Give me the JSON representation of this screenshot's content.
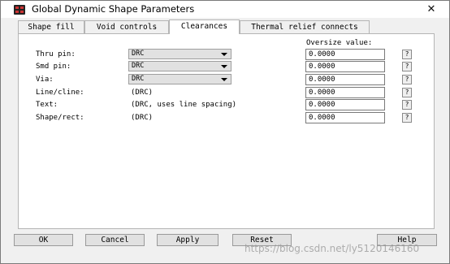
{
  "window": {
    "title": "Global Dynamic Shape Parameters",
    "close_glyph": "✕"
  },
  "tabs": [
    {
      "label": "Shape fill",
      "active": false
    },
    {
      "label": "Void controls",
      "active": false
    },
    {
      "label": "Clearances",
      "active": true
    },
    {
      "label": "Thermal relief connects",
      "active": false
    }
  ],
  "clearances": {
    "oversize_header": "Oversize value:",
    "rows": [
      {
        "label": "Thru pin:",
        "value": "DRC",
        "oversize": "0.0000",
        "help": "?"
      },
      {
        "label": "Smd pin:",
        "value": "DRC",
        "oversize": "0.0000",
        "help": "?"
      },
      {
        "label": "Via:",
        "value": "DRC",
        "oversize": "0.0000",
        "help": "?"
      },
      {
        "label": "Line/cline:",
        "value": "(DRC)",
        "oversize": "0.0000",
        "help": "?"
      },
      {
        "label": "Text:",
        "value": "(DRC, uses line spacing)",
        "oversize": "0.0000",
        "help": "?"
      },
      {
        "label": "Shape/rect:",
        "value": "(DRC)",
        "oversize": "0.0000",
        "help": "?"
      }
    ]
  },
  "buttons": {
    "ok": "OK",
    "cancel": "Cancel",
    "apply": "Apply",
    "reset": "Reset",
    "help": "Help"
  },
  "watermark": "https://blog.csdn.net/ly5120146160",
  "icons": {
    "app": "app-icon",
    "close": "close-icon",
    "dropdown": "chevron-down-icon"
  }
}
